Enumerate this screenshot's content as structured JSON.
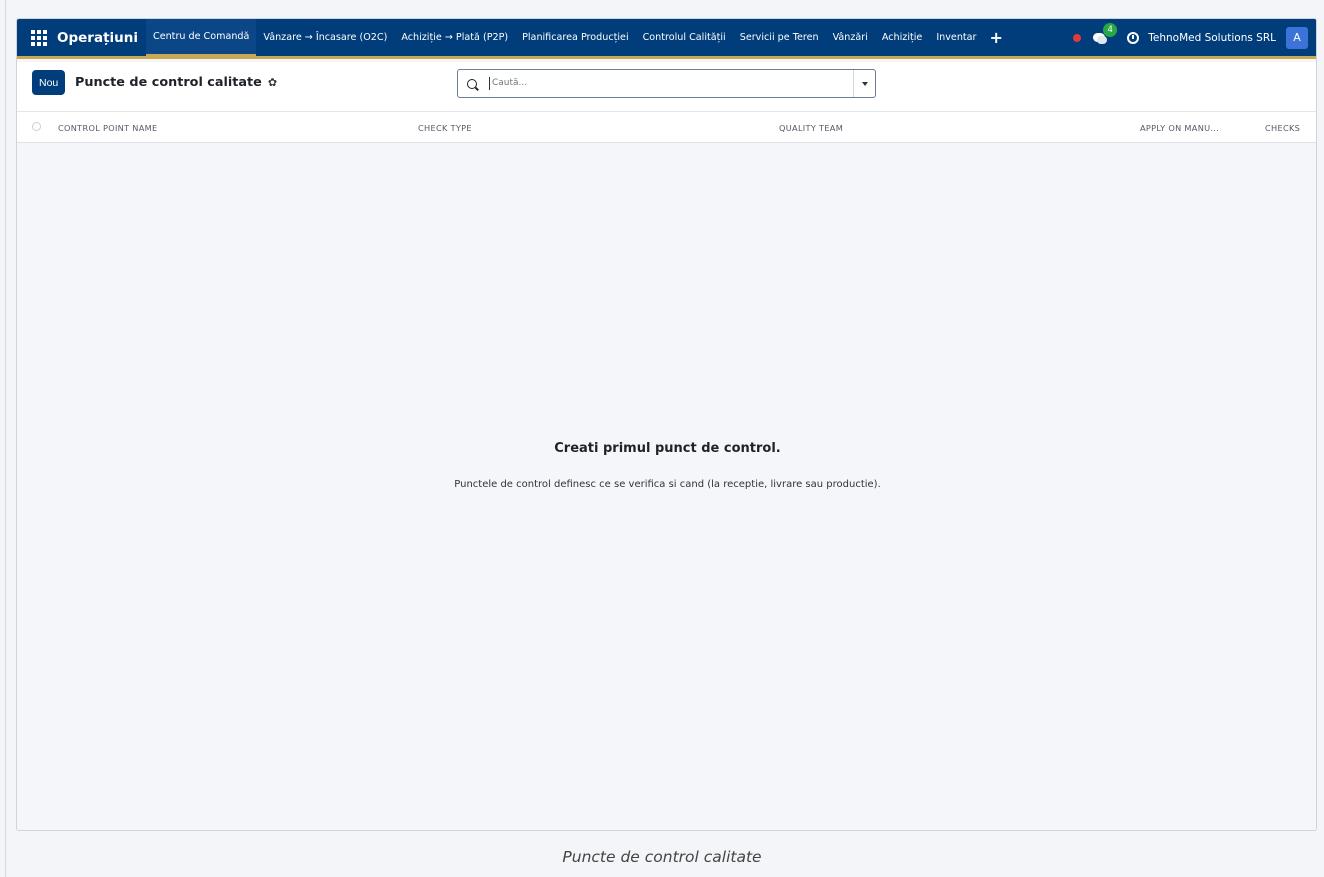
{
  "navbar": {
    "app_name": "Operațiuni",
    "menu": [
      {
        "label": "Centru de Comandă",
        "active": true
      },
      {
        "label": "Vânzare → Încasare (O2C)"
      },
      {
        "label": "Achiziție → Plată (P2P)"
      },
      {
        "label": "Planificarea Producției"
      },
      {
        "label": "Controlul Calității"
      },
      {
        "label": "Servicii pe Teren"
      },
      {
        "label": "Vânzări"
      },
      {
        "label": "Achiziție"
      },
      {
        "label": "Inventar"
      }
    ],
    "plus": "+",
    "chat_count": "4",
    "company": "TehnoMed Solutions SRL",
    "avatar": "A",
    "accent_color": "#003d7a",
    "gold_color": "#c8a951"
  },
  "control_panel": {
    "new_label": "Nou",
    "title": "Puncte de control calitate",
    "search_placeholder": "Caută..."
  },
  "list": {
    "columns": [
      "CONTROL POINT NAME",
      "CHECK TYPE",
      "QUALITY TEAM",
      "APPLY ON MANU...",
      "CHECKS"
    ]
  },
  "empty_state": {
    "title": "Creati primul punct de control.",
    "description": "Punctele de control definesc ce se verifica si cand (la receptie, livrare sau productie)."
  },
  "caption": "Puncte de control calitate"
}
